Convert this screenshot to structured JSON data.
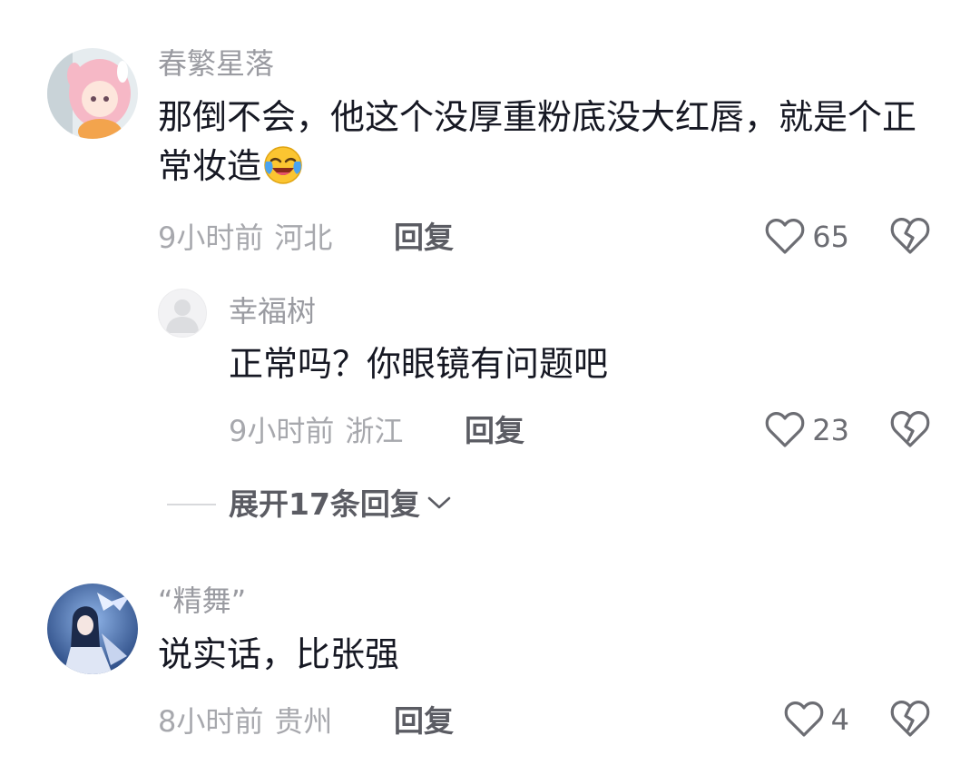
{
  "comments": [
    {
      "username": "春繁星落",
      "content": "那倒不会，他这个没厚重粉底没大红唇，就是个正常妆造",
      "emoji": "laughing-crying-emoji",
      "time": "9小时前",
      "location": "河北",
      "reply_label": "回复",
      "likes": "65",
      "replies": [
        {
          "username": "幸福树",
          "content": "正常吗？你眼镜有问题吧",
          "time": "9小时前",
          "location": "浙江",
          "reply_label": "回复",
          "likes": "23"
        }
      ],
      "expand_label": "展开17条回复"
    },
    {
      "username": "“精舞”",
      "content": "说实话，比张强",
      "time": "8小时前",
      "location": "贵州",
      "reply_label": "回复",
      "likes": "4"
    }
  ],
  "icons": {
    "like": "heart-outline-icon",
    "dislike": "broken-heart-icon",
    "expand": "chevron-down-icon"
  },
  "colors": {
    "text_primary": "#161823",
    "text_secondary": "#9a9ba1",
    "reply_button": "#5b5c63"
  }
}
